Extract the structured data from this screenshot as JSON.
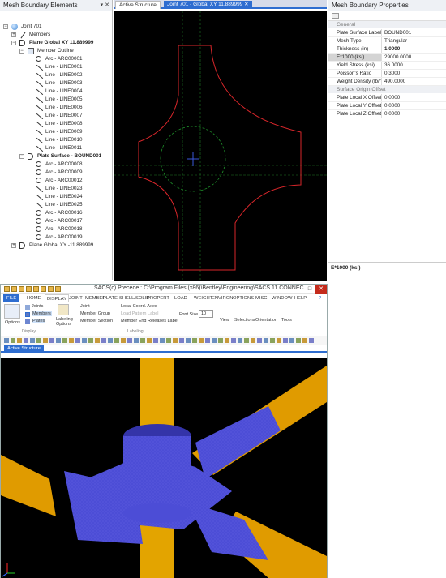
{
  "left_panel": {
    "title": "Mesh Boundary Elements",
    "controls": "▾ ✕",
    "tree": [
      {
        "label": "Joint 701",
        "level": 0,
        "icon": "sphere-icon",
        "exp": "−",
        "bold": false
      },
      {
        "label": "Members",
        "level": 1,
        "icon": "members-icon",
        "exp": "+",
        "bold": false
      },
      {
        "label": "Plane Global XY 11.889999",
        "level": 1,
        "icon": "plate-icon",
        "exp": "−",
        "bold": true
      },
      {
        "label": "Member Outline",
        "level": 2,
        "icon": "outline-icon",
        "exp": "−",
        "bold": false
      },
      {
        "label": "Arc - ARC00001",
        "level": 3,
        "icon": "arc-icon"
      },
      {
        "label": "Line - LINE0001",
        "level": 3,
        "icon": "line-icon"
      },
      {
        "label": "Line - LINE0002",
        "level": 3,
        "icon": "line-icon"
      },
      {
        "label": "Line - LINE0003",
        "level": 3,
        "icon": "line-icon"
      },
      {
        "label": "Line - LINE0004",
        "level": 3,
        "icon": "line-icon"
      },
      {
        "label": "Line - LINE0005",
        "level": 3,
        "icon": "line-icon"
      },
      {
        "label": "Line - LINE0006",
        "level": 3,
        "icon": "line-icon"
      },
      {
        "label": "Line - LINE0007",
        "level": 3,
        "icon": "line-icon"
      },
      {
        "label": "Line - LINE0008",
        "level": 3,
        "icon": "line-icon"
      },
      {
        "label": "Line - LINE0009",
        "level": 3,
        "icon": "line-icon"
      },
      {
        "label": "Line - LINE0010",
        "level": 3,
        "icon": "line-icon"
      },
      {
        "label": "Line - LINE0011",
        "level": 3,
        "icon": "line-icon"
      },
      {
        "label": "Plate Surface - BOUND001",
        "level": 2,
        "icon": "plate-icon",
        "exp": "−",
        "bold": true
      },
      {
        "label": "Arc - ARC00008",
        "level": 3,
        "icon": "arc-icon"
      },
      {
        "label": "Arc - ARC00009",
        "level": 3,
        "icon": "arc-icon"
      },
      {
        "label": "Arc - ARC00012",
        "level": 3,
        "icon": "arc-icon"
      },
      {
        "label": "Line - LINE0023",
        "level": 3,
        "icon": "line-icon"
      },
      {
        "label": "Line - LINE0024",
        "level": 3,
        "icon": "line-icon"
      },
      {
        "label": "Line - LINE0025",
        "level": 3,
        "icon": "line-icon"
      },
      {
        "label": "Arc - ARC00016",
        "level": 3,
        "icon": "arc-icon"
      },
      {
        "label": "Arc - ARC00017",
        "level": 3,
        "icon": "arc-icon"
      },
      {
        "label": "Arc - ARC00018",
        "level": 3,
        "icon": "arc-icon"
      },
      {
        "label": "Arc - ARC00019",
        "level": 3,
        "icon": "arc-icon"
      },
      {
        "label": "Plane Global XY -11.889999",
        "level": 1,
        "icon": "plate-icon",
        "exp": "+",
        "bold": false
      }
    ]
  },
  "center_panel": {
    "tabs": [
      {
        "label": "Active Structure",
        "active": false
      },
      {
        "label": "Joint 701 - Global XY 11.889999",
        "active": true
      }
    ],
    "tab_close": "✕",
    "colors": {
      "background": "#000000",
      "outline": "#d8262a",
      "circle": "#1e8f2a",
      "grid": "#1f7a25",
      "axis_blue": "#3a57d8"
    }
  },
  "right_panel": {
    "title": "Mesh Boundary Properties",
    "categories": [
      {
        "name": "General",
        "rows": [
          {
            "key": "Plate Surface Label",
            "value": "BOUND001",
            "bold": false
          },
          {
            "key": "Mesh Type",
            "value": "Triangular",
            "bold": false
          },
          {
            "key": "Thickness (in)",
            "value": "1.0000",
            "bold": true
          },
          {
            "key": "E*1000 (ksi)",
            "value": "29000.0000",
            "bold": false,
            "selected": true
          },
          {
            "key": "Yield Stress (ksi)",
            "value": "36.0000",
            "bold": false
          },
          {
            "key": "Poisson's Ratio",
            "value": "0.3000",
            "bold": false
          },
          {
            "key": "Weight Density (lb/ft",
            "value": "490.0000",
            "bold": false
          }
        ]
      },
      {
        "name": "Surface Origin Offset",
        "rows": [
          {
            "key": "Plate Local X Offset (i",
            "value": "0.0000",
            "bold": false
          },
          {
            "key": "Plate Local Y Offset (i",
            "value": "0.0000",
            "bold": false
          },
          {
            "key": "Plate Local Z Offset (i",
            "value": "0.0000",
            "bold": false
          }
        ]
      }
    ],
    "description": "E*1000 (ksi)"
  },
  "app": {
    "title": "SACS(c) Precede : C:\\Program Files (x86)\\Bentley\\Engineering\\SACS 11 CONNEC...",
    "window_buttons": [
      "—",
      "□",
      "✕"
    ],
    "menu": [
      "FILE",
      "HOME",
      "DISPLAY",
      "JOINT",
      "MEMBER",
      "PLATE",
      "SHELL/SOLID",
      "PROPERT",
      "LOAD",
      "WEIGHT",
      "ENVIRON",
      "OPTIONS",
      "MISC",
      "WINDOW",
      "HELP"
    ],
    "menu_active": "DISPLAY",
    "ribbon": {
      "options_label": "Options",
      "display_items": [
        "Joints",
        "Members",
        "Plates"
      ],
      "display_group": "Display",
      "labeling_options": "Labeling Options",
      "label_items": [
        "Joint",
        "Member Group",
        "Member Section"
      ],
      "label_items2": [
        "Local Coord. Axes",
        "Load Pattern Label",
        "Member End Releases Label"
      ],
      "labeling_group": "Labeling",
      "font_size_label": "Font Size",
      "font_size_value": "10",
      "view_label": "View",
      "selections_label": "Selections",
      "orientation_label": "Orientation",
      "tools_label": "Tools"
    },
    "doc_tab": "Active Structure",
    "scene_colors": {
      "background": "#000000",
      "leg": "#e3a400",
      "brace": "#e09b00",
      "mesh": "#4c4dd6",
      "mesh_dark": "#3434a8"
    }
  }
}
